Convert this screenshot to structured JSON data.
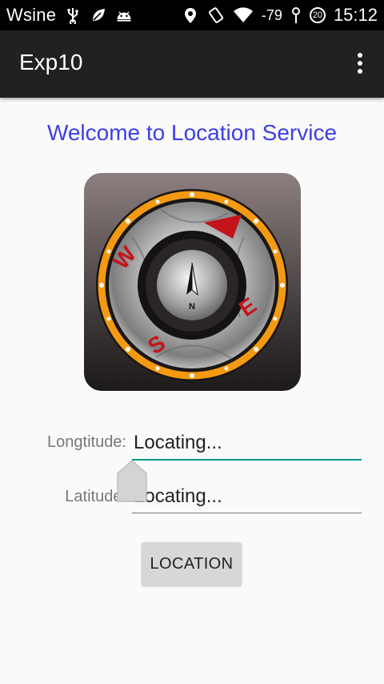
{
  "status_bar": {
    "carrier": "Wsine",
    "signal_strength": "-79",
    "badge_count": "20",
    "time": "15:12",
    "icons": [
      "usb-icon",
      "leaf-icon",
      "android-icon",
      "location-icon",
      "rotate-icon",
      "wifi-icon",
      "signal-icon"
    ]
  },
  "action_bar": {
    "title": "Exp10",
    "overflow_icon": "overflow-menu-icon"
  },
  "main": {
    "welcome_text": "Welcome to Location Service",
    "compass_image": "compass-icon",
    "compass_letters": {
      "west": "W",
      "east": "E",
      "south": "S",
      "needle": "N"
    },
    "longitude": {
      "label": "Longtitude:",
      "value": "Locating..."
    },
    "latitude": {
      "label": "Latitude:",
      "value": "Locating..."
    },
    "location_button": "LOCATION"
  },
  "colors": {
    "status_bar_bg": "#000000",
    "action_bar_bg": "#212121",
    "welcome_text": "#3d3ee6",
    "focused_underline": "#009688",
    "button_bg": "#d6d7d7"
  }
}
